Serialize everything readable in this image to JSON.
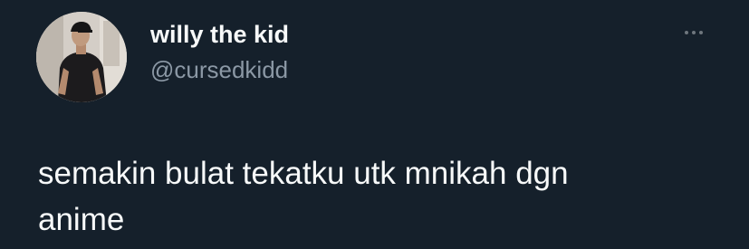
{
  "tweet": {
    "author": {
      "display_name": "willy the kid",
      "handle": "@cursedkidd"
    },
    "more_icon": "more-horizontal-icon",
    "text": "semakin bulat tekatku utk mnikah dgn\nanime"
  },
  "colors": {
    "background": "#15202b",
    "primary_text": "#f7f9f9",
    "secondary_text": "#8b98a5",
    "more_icon": "#6e767d"
  }
}
